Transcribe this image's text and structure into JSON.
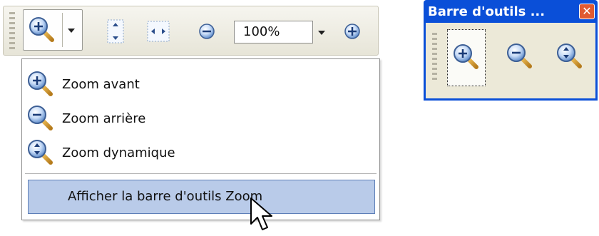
{
  "toolbar": {
    "zoom_value": "100%",
    "icons": [
      "zoom-in-icon",
      "dropdown-arrow-icon",
      "fit-page-height-icon",
      "fit-page-width-icon",
      "zoom-out-icon",
      "zoom-dropdown-arrow-icon",
      "zoom-in-icon"
    ]
  },
  "menu": {
    "items": [
      {
        "label": "Zoom avant",
        "icon": "zoom-in-icon"
      },
      {
        "label": "Zoom arrière",
        "icon": "zoom-out-icon"
      },
      {
        "label": "Zoom dynamique",
        "icon": "zoom-dynamic-icon"
      }
    ],
    "show_toolbar_label": "Afficher la barre d'outils Zoom"
  },
  "float_toolbar": {
    "title": "Barre d'outils ...",
    "close_symbol": "✕",
    "icons": [
      "zoom-in-icon",
      "zoom-out-icon",
      "zoom-dynamic-icon"
    ]
  },
  "colors": {
    "highlight": "#b9cbe9",
    "title_bar": "#0a4fd8",
    "close_button": "#e05a32"
  }
}
